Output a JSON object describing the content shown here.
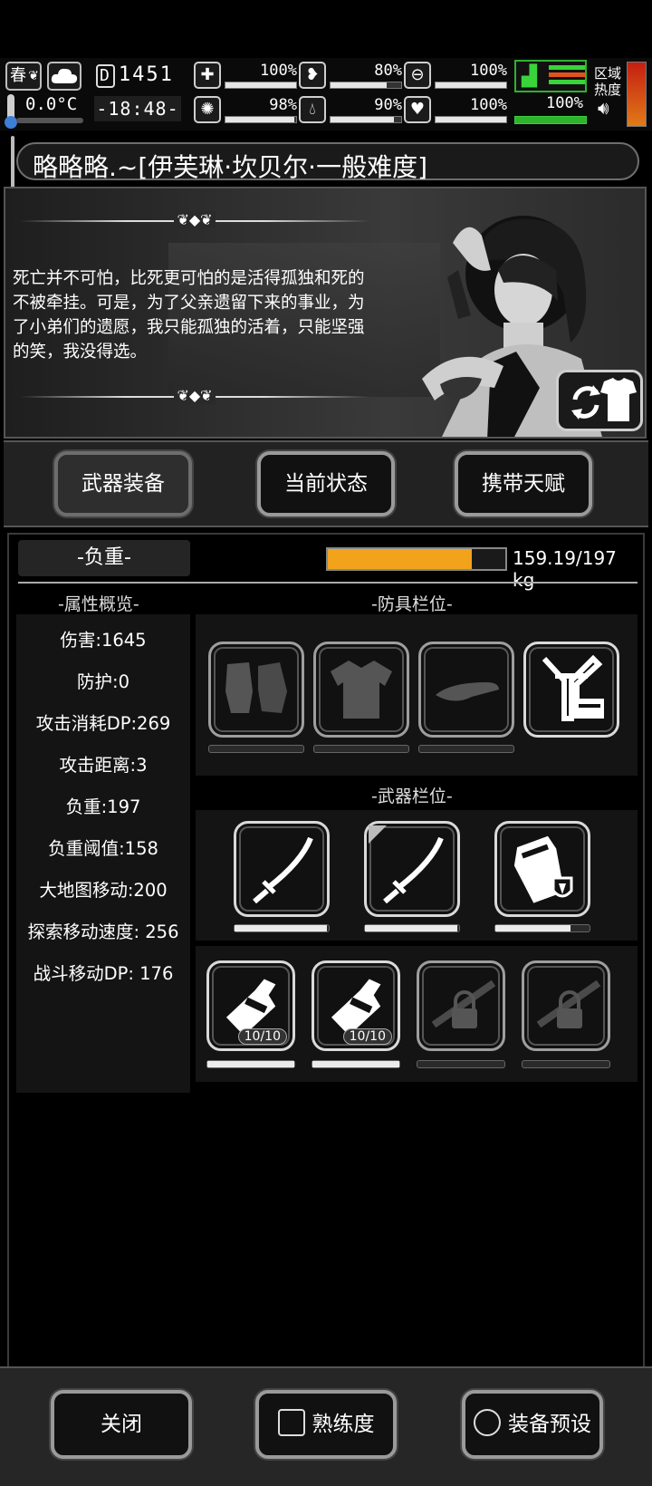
{
  "hud": {
    "season": "春",
    "temperature": "0.0°C",
    "day": "1451",
    "time": "-18:48-",
    "stats": [
      {
        "name": "health",
        "icon": "medkit-icon",
        "value": "100%",
        "fill": 1.0
      },
      {
        "name": "hunger",
        "icon": "stomach-icon",
        "value": "80%",
        "fill": 0.8
      },
      {
        "name": "bladder",
        "icon": "toilet-icon",
        "value": "100%",
        "fill": 1.0
      },
      {
        "name": "mind",
        "icon": "brain-icon",
        "value": "98%",
        "fill": 0.98
      },
      {
        "name": "thirst",
        "icon": "water-drop-icon",
        "value": "90%",
        "fill": 0.9
      },
      {
        "name": "mood",
        "icon": "heart-icon",
        "value": "100%",
        "fill": 1.0
      }
    ],
    "stamina": {
      "value": "100%",
      "fill": 1.0
    },
    "zone_label": "区域\n热度",
    "accent_green": "#39d43a",
    "accent_orange": "#f2a31c"
  },
  "title": "略略略.~[伊芙琳·坎贝尔·一般难度]",
  "story": {
    "quote": "死亡并不可怕，比死更可怕的是活得孤独和死的不被牵挂。可是，为了父亲遗留下来的事业，为了小弟们的遗愿，我只能孤独的活着，只能坚强的笑，我没得选。"
  },
  "tabs": [
    {
      "label": "武器装备",
      "active": true
    },
    {
      "label": "当前状态",
      "active": false
    },
    {
      "label": "携带天赋",
      "active": false
    }
  ],
  "load": {
    "label": "-负重-",
    "text": "159.19/197 kg",
    "fill": 0.808
  },
  "sections": {
    "attributes": "-属性概览-",
    "armor": "-防具栏位-",
    "weapons": "-武器栏位-"
  },
  "attributes": [
    "伤害:1645",
    "防护:0",
    "攻击消耗DP:269",
    "攻击距离:3",
    "负重:197",
    "负重阈值:158",
    "大地图移动:200",
    "探索移动速度: 256",
    "战斗移动DP: 176"
  ],
  "armor_slots": [
    {
      "icon": "gloves-icon",
      "filled": false
    },
    {
      "icon": "shirt-icon",
      "filled": false
    },
    {
      "icon": "cap-icon",
      "filled": false
    },
    {
      "icon": "backpack-frame-icon",
      "filled": true
    }
  ],
  "weapon_slots": [
    {
      "icon": "katana-icon",
      "durability": 0.98
    },
    {
      "icon": "katana-icon",
      "durability": 0.98
    },
    {
      "icon": "shield-pack-icon",
      "durability": 0.8
    }
  ],
  "item_slots": [
    {
      "icon": "molotov-icon",
      "count": "10/10",
      "filled": true
    },
    {
      "icon": "molotov-icon",
      "count": "10/10",
      "filled": true
    },
    {
      "icon": "locked-slot-icon",
      "count": "",
      "filled": false
    },
    {
      "icon": "locked-slot-icon",
      "count": "",
      "filled": false
    }
  ],
  "bottom": {
    "close": "关闭",
    "proficiency": "熟练度",
    "preset": "装备预设"
  }
}
